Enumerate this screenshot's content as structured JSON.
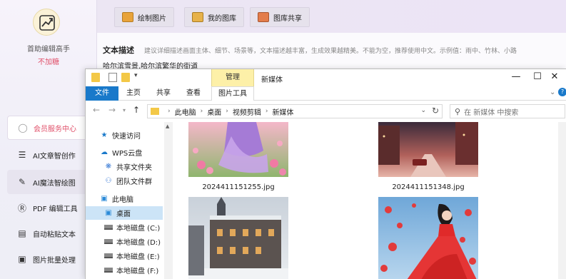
{
  "app": {
    "brand_name": "首助编辑高手",
    "brand_sub": "不加糖",
    "sidebar": [
      {
        "label": "会员服务中心",
        "icon": "user-icon"
      },
      {
        "label": "AI文章智创作",
        "icon": "list-icon"
      },
      {
        "label": "AI魔法智绘图",
        "icon": "brush-icon"
      },
      {
        "label": "PDF 编辑工具",
        "icon": "pdf-icon"
      },
      {
        "label": "自动粘贴文本",
        "icon": "paste-icon"
      },
      {
        "label": "图片批量处理",
        "icon": "image-icon"
      }
    ],
    "top_tabs": [
      {
        "label": "绘制图片",
        "icon": "draw-image-icon"
      },
      {
        "label": "我的图库",
        "icon": "gallery-icon"
      },
      {
        "label": "图库共享",
        "icon": "share-gallery-icon"
      }
    ],
    "desc_label": "文本描述",
    "desc_hint": "建议详细描述画面主体、细节、场景等，文本描述越丰富，生成效果越精美。不能为空，推荐使用中文。示例值：雨中、竹林、小路",
    "desc_value": "哈尔滨雪景,哈尔滨繁华的街道"
  },
  "explorer": {
    "manage_tab": "管理",
    "title": "新媒体",
    "ribbon_tabs": [
      "文件",
      "主页",
      "共享",
      "查看",
      "图片工具"
    ],
    "address_path": [
      "此电脑",
      "桌面",
      "视频剪辑",
      "新媒体"
    ],
    "search_placeholder": "在 新媒体 中搜索",
    "nav_items": [
      {
        "label": "快速访问",
        "icon": "star-icon"
      },
      {
        "label": "WPS云盘",
        "icon": "cloud-icon"
      },
      {
        "label": "共享文件夹",
        "icon": "share-folder-icon"
      },
      {
        "label": "团队文件群",
        "icon": "team-icon"
      },
      {
        "label": "此电脑",
        "icon": "computer-icon"
      },
      {
        "label": "桌面",
        "icon": "desktop-icon"
      },
      {
        "label": "本地磁盘 (C:)",
        "icon": "drive-icon"
      },
      {
        "label": "本地磁盘 (D:)",
        "icon": "drive-icon"
      },
      {
        "label": "本地磁盘 (E:)",
        "icon": "drive-icon"
      },
      {
        "label": "本地磁盘 (F:)",
        "icon": "drive-icon"
      }
    ],
    "files": [
      {
        "name": "2024411151255.jpg"
      },
      {
        "name": "2024411151348.jpg"
      }
    ]
  },
  "colors": {
    "accent_blue": "#1979ca",
    "manage_yellow": "#fdf0a8",
    "pink_accent": "#e0506a"
  }
}
